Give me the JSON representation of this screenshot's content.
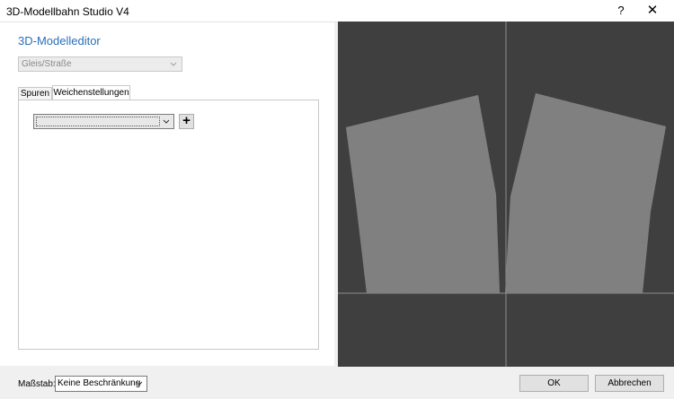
{
  "window": {
    "title": "3D-Modellbahn Studio V4",
    "help_label": "?",
    "close_label": "✕"
  },
  "editor": {
    "heading": "3D-Modelleditor",
    "category": {
      "value": "Gleis/Straße",
      "disabled": true
    },
    "tabs": [
      {
        "label": "Spuren",
        "active": false
      },
      {
        "label": "Weichenstellungen",
        "active": true
      }
    ],
    "setting_select": {
      "value": ""
    },
    "add_button_label": "+"
  },
  "viewport": {
    "background_color": "#3f3f3f",
    "axis_color": "#8c8c8c",
    "model_color": "#808080"
  },
  "footer": {
    "scale_label": "Maßstab:",
    "scale_value": "Keine Beschränkung",
    "ok_label": "OK",
    "cancel_label": "Abbrechen"
  },
  "icons": {
    "chevron": "chevron-down-icon",
    "add": "plus-icon",
    "close": "close-icon",
    "help": "help-icon"
  }
}
